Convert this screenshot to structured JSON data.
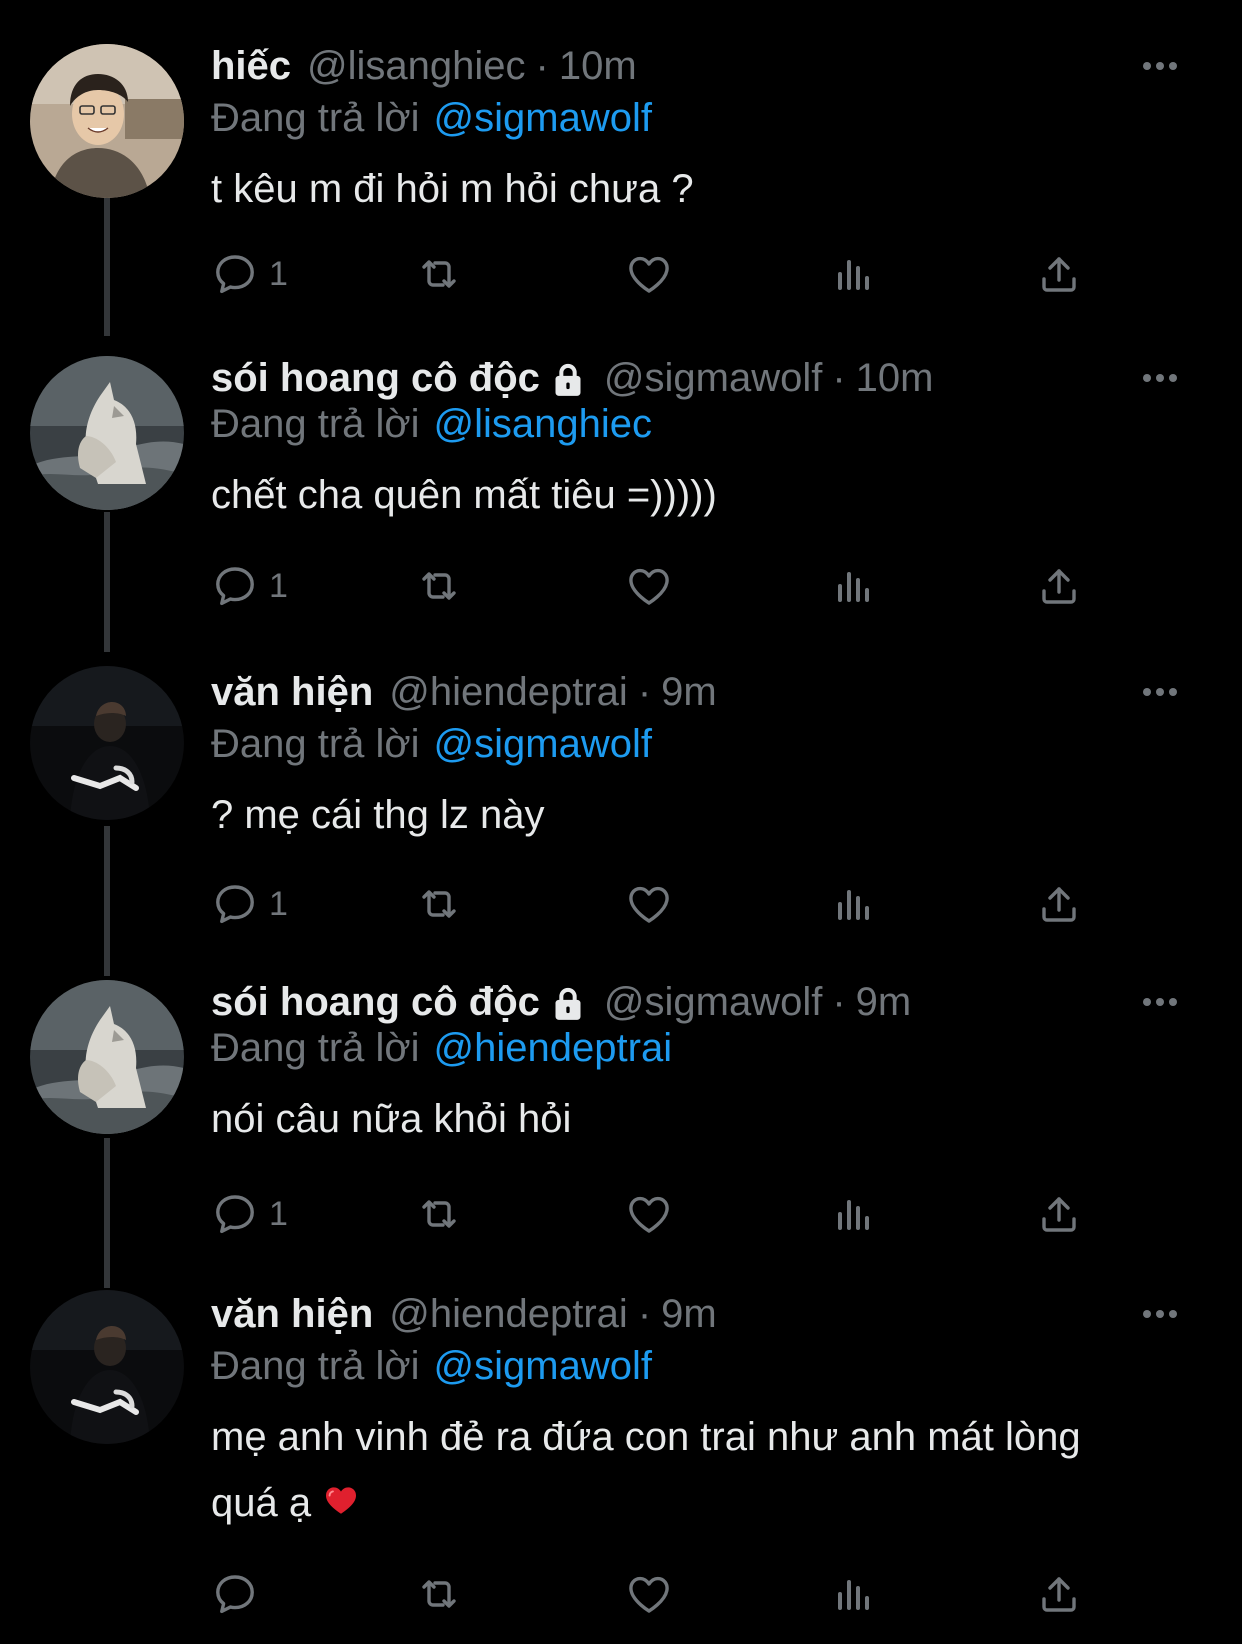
{
  "colors": {
    "background": "#000000",
    "primary_text": "#e7e9ea",
    "secondary_text": "#71767b",
    "mention": "#1d9bf0",
    "thread_line": "#333639"
  },
  "tweets": [
    {
      "name": "hiếc",
      "handle": "@lisanghiec",
      "separator": "·",
      "time": "10m",
      "replying_prefix": "Đang trả lời",
      "replying_to": "@sigmawolf",
      "text": "t kêu m đi hỏi m hỏi chưa ?",
      "reply_count": "1",
      "locked": false,
      "avatar_icon": "avatar-hiec"
    },
    {
      "name": "sói hoang cô độc",
      "handle": "@sigmawolf",
      "separator": "·",
      "time": "10m",
      "replying_prefix": "Đang trả lời",
      "replying_to": "@lisanghiec",
      "text": "chết cha quên mất tiêu =)))))",
      "reply_count": "1",
      "locked": true,
      "avatar_icon": "avatar-wolf"
    },
    {
      "name": "văn hiện",
      "handle": "@hiendeptrai",
      "separator": "·",
      "time": "9m",
      "replying_prefix": "Đang trả lời",
      "replying_to": "@sigmawolf",
      "text": "? mẹ cái thg lz này",
      "reply_count": "1",
      "locked": false,
      "avatar_icon": "avatar-hien"
    },
    {
      "name": "sói hoang cô độc",
      "handle": "@sigmawolf",
      "separator": "·",
      "time": "9m",
      "replying_prefix": "Đang trả lời",
      "replying_to": "@hiendeptrai",
      "text": "nói câu nữa khỏi hỏi",
      "reply_count": "1",
      "locked": true,
      "avatar_icon": "avatar-wolf"
    },
    {
      "name": "văn hiện",
      "handle": "@hiendeptrai",
      "separator": "·",
      "time": "9m",
      "replying_prefix": "Đang trả lời",
      "replying_to": "@sigmawolf",
      "text_line1": "mẹ anh vinh đẻ ra đứa con trai như anh mát lòng",
      "text_line2": "quá ạ",
      "reply_count": "",
      "locked": false,
      "avatar_icon": "avatar-hien"
    }
  ]
}
